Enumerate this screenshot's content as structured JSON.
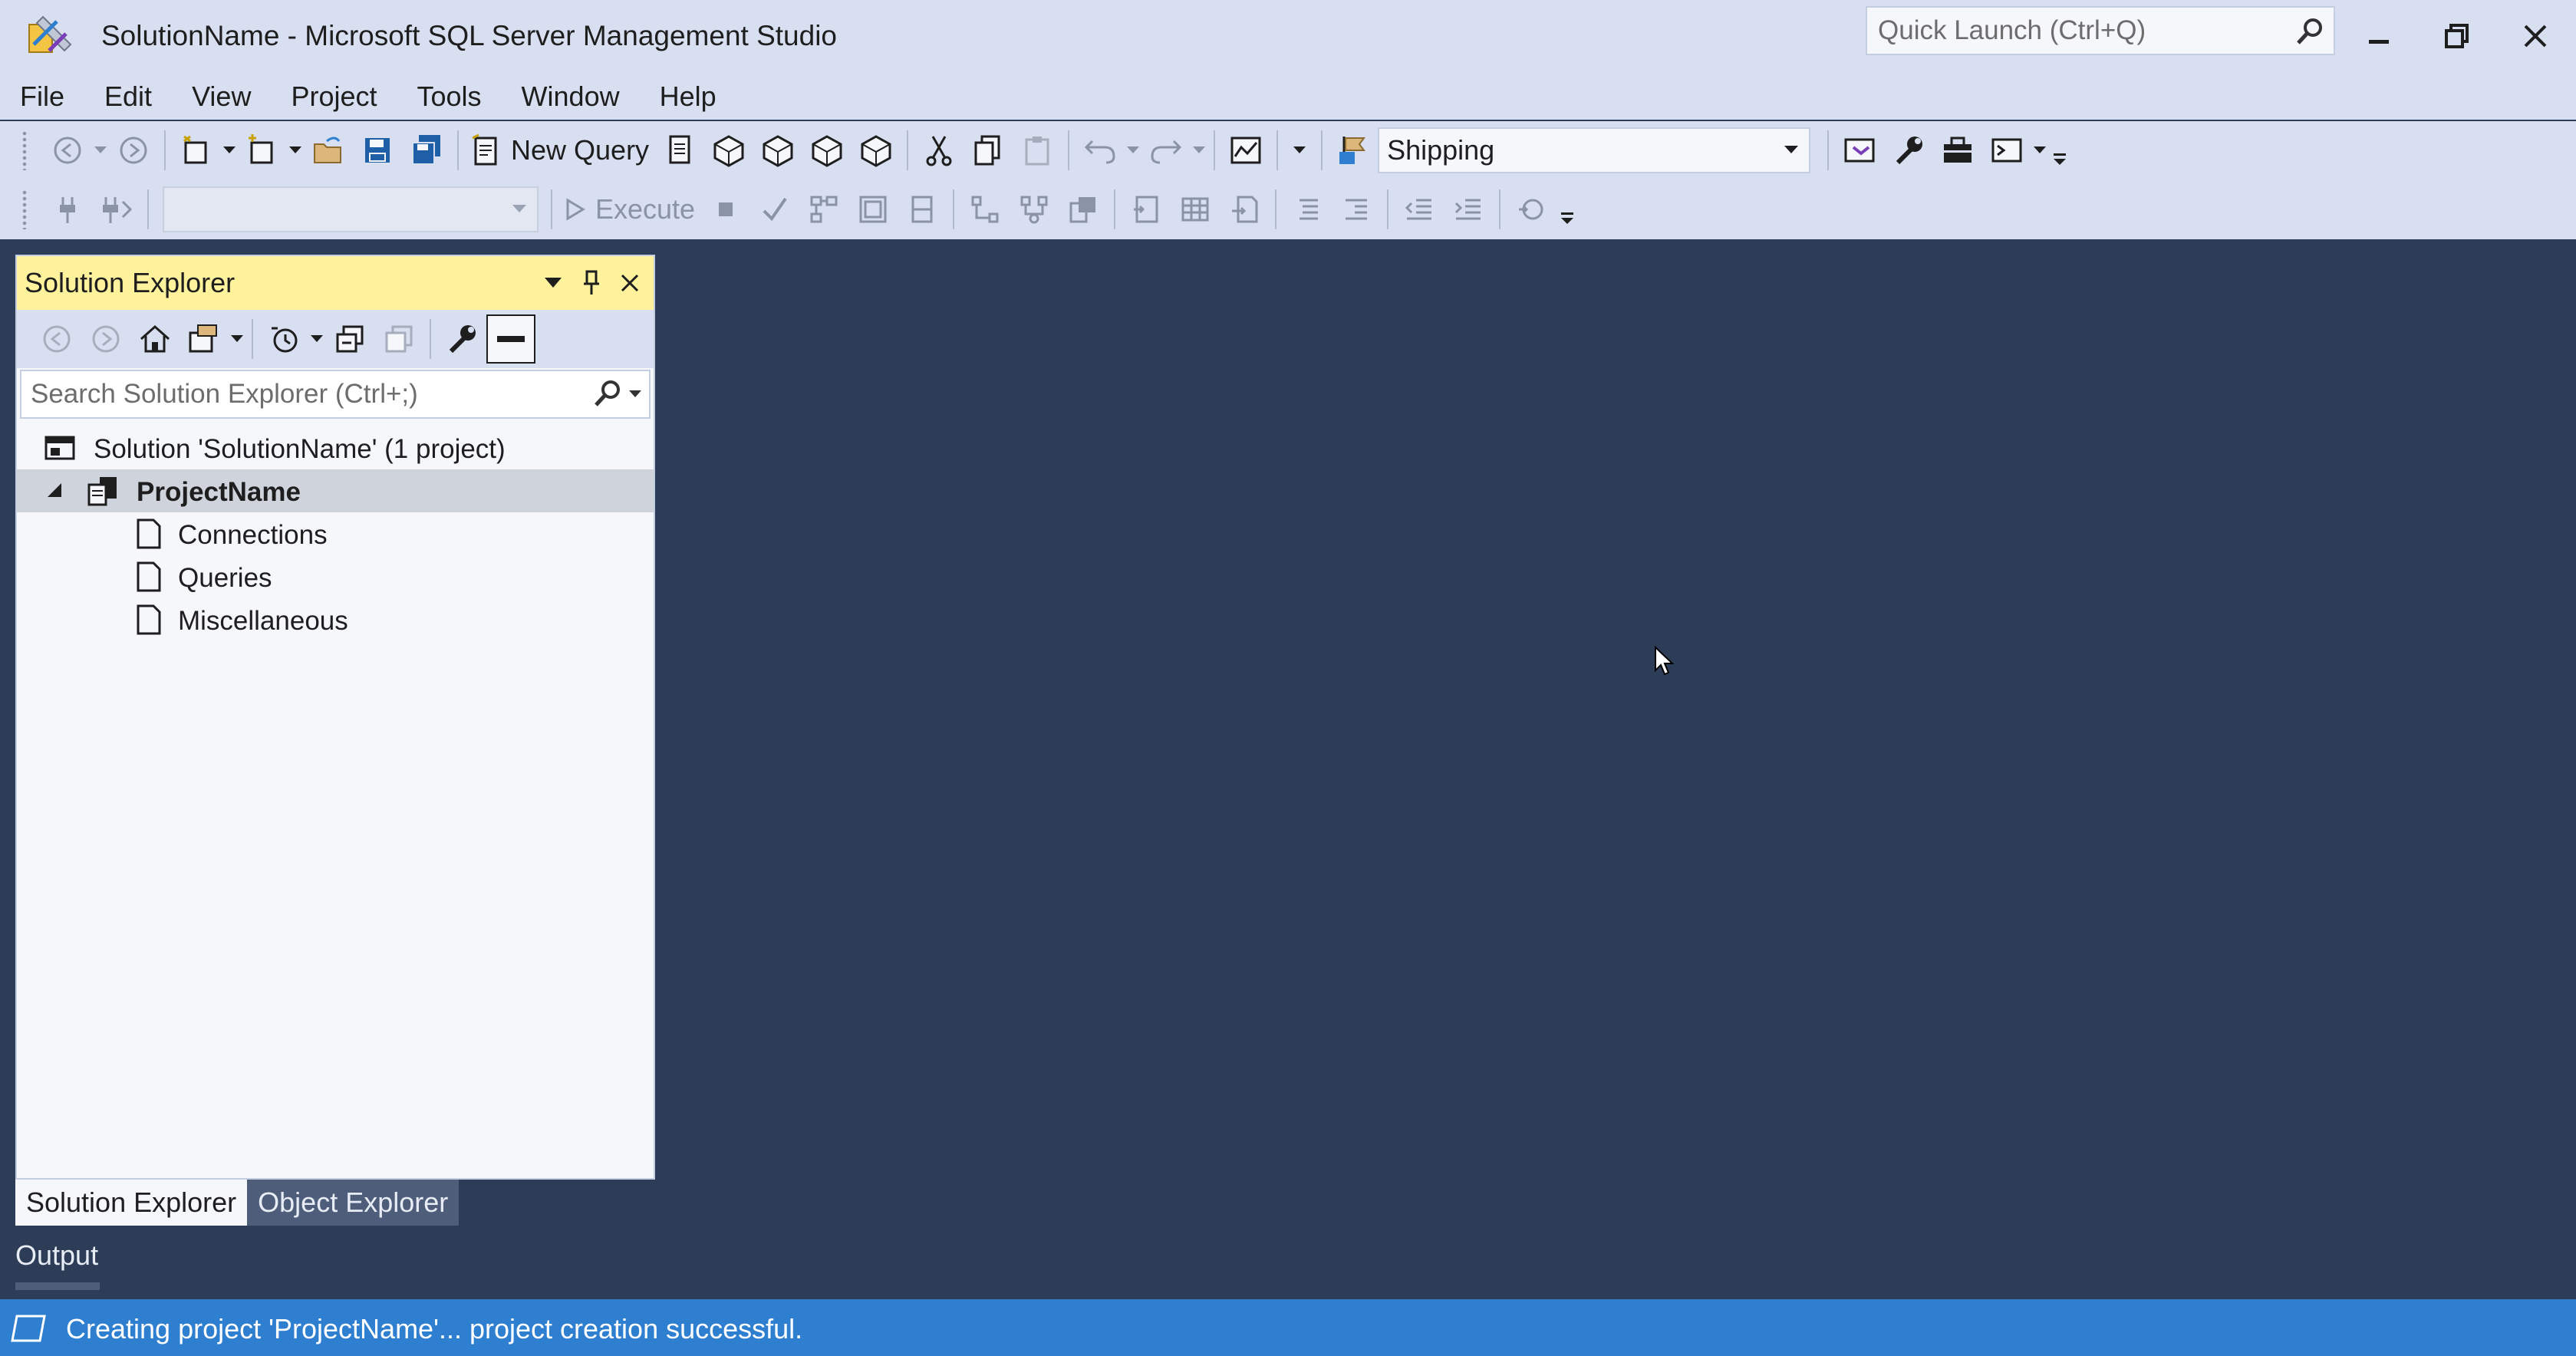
{
  "window": {
    "title": "SolutionName - Microsoft SQL Server Management Studio",
    "quick_launch_placeholder": "Quick Launch (Ctrl+Q)"
  },
  "menu": [
    "File",
    "Edit",
    "View",
    "Project",
    "Tools",
    "Window",
    "Help"
  ],
  "toolbar": {
    "new_query_label": "New Query",
    "solution_config": "Shipping",
    "execute_label": "Execute",
    "database_combo": ""
  },
  "solution_explorer": {
    "title": "Solution Explorer",
    "search_placeholder": "Search Solution Explorer (Ctrl+;)",
    "tree": {
      "solution": "Solution 'SolutionName' (1 project)",
      "project": "ProjectName",
      "folders": [
        "Connections",
        "Queries",
        "Miscellaneous"
      ]
    }
  },
  "bottom_tabs": [
    "Solution Explorer",
    "Object Explorer"
  ],
  "output_label": "Output",
  "status": {
    "text": "Creating project 'ProjectName'... project creation successful."
  },
  "colors": {
    "chrome": "#d8dff0",
    "panel_header": "#fff29d",
    "status_bar": "#2f7fd1",
    "workspace": "#2e3d57"
  }
}
